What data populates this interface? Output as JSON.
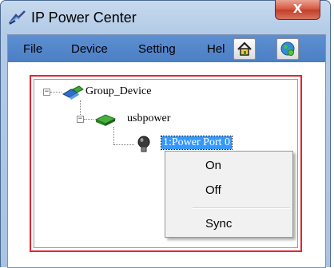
{
  "window": {
    "title": "IP Power Center",
    "close_glyph": "X"
  },
  "menubar": {
    "items": [
      "File",
      "Device",
      "Setting",
      "Hel"
    ]
  },
  "toolbar": {
    "icons": [
      "home-icon",
      "globe-icon"
    ]
  },
  "tree": {
    "root": {
      "label": "Group_Device",
      "expanded": true,
      "icon": "network-group-icon"
    },
    "device": {
      "label": "usbpower",
      "expanded": true,
      "icon": "device-icon"
    },
    "port": {
      "label": "1:Power Port 0",
      "selected": true,
      "icon": "bulb-icon"
    }
  },
  "context_menu": {
    "items": [
      "On",
      "Off",
      "Sync"
    ]
  },
  "colors": {
    "menubar": "#5d8fd2",
    "highlight_frame": "#e2262d",
    "selection": "#3399ff"
  }
}
